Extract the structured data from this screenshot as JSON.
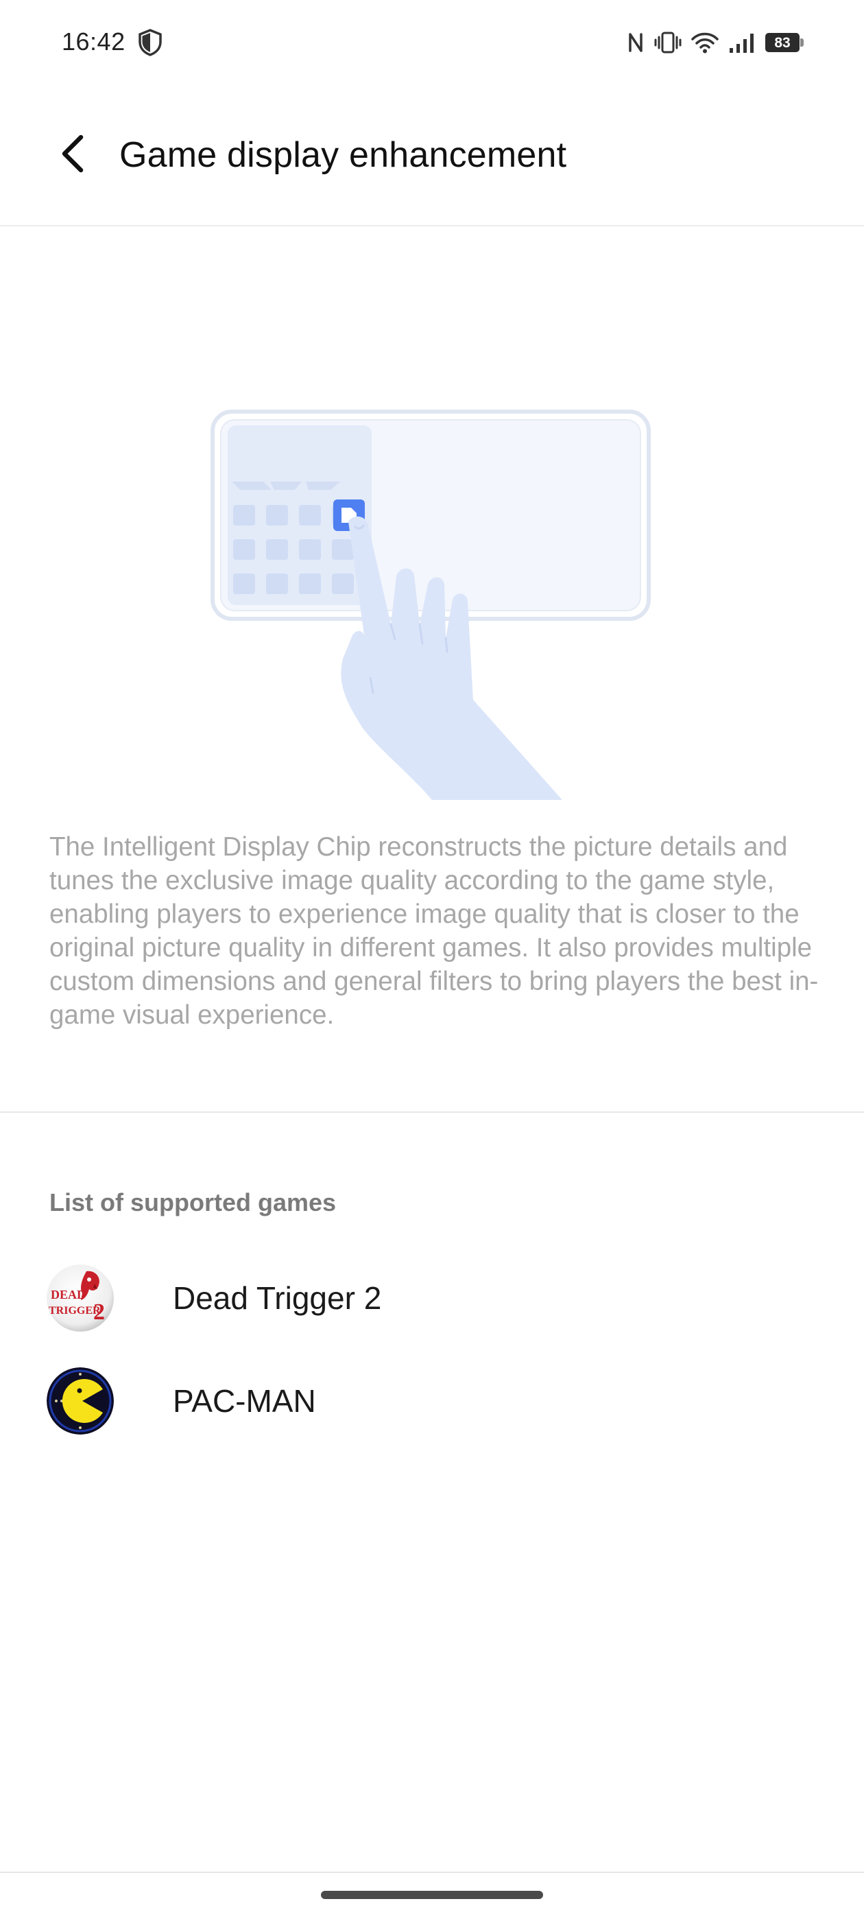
{
  "status_bar": {
    "time": "16:42",
    "battery": "83",
    "icons": [
      "shield-icon",
      "nfc-icon",
      "vibrate-icon",
      "wifi-icon",
      "signal-icon",
      "battery-icon"
    ]
  },
  "header": {
    "back_icon": "back-arrow-icon",
    "title": "Game display enhancement"
  },
  "description": "The Intelligent Display Chip reconstructs the picture details and tunes the exclusive image quality according to the game style, enabling players to experience image quality that is closer to the original picture quality in different games. It also provides multiple custom dimensions and general filters to bring players the best in-game visual experience.",
  "supported_games": {
    "header": "List of supported games",
    "items": [
      {
        "name": "Dead Trigger 2",
        "icon": "dead-trigger-2-icon",
        "icon_text": [
          "DEAD",
          "TRIGGER",
          "2"
        ]
      },
      {
        "name": "PAC-MAN",
        "icon": "pac-man-icon"
      }
    ]
  },
  "colors": {
    "illustration_fill": "#dbe5f9",
    "illustration_accent": "#4f7ff0",
    "description_text": "#a7a7a7",
    "dead_trigger_red": "#c8202a",
    "pacman_yellow": "#f7e21a",
    "pacman_bg": "#0d0d26"
  }
}
